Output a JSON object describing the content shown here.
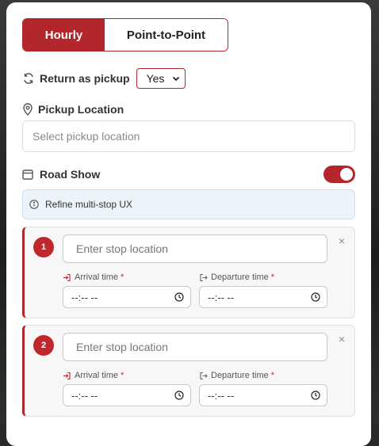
{
  "trip_type": {
    "tabs": [
      {
        "label": "Hourly",
        "active": true
      },
      {
        "label": "Point-to-Point",
        "active": false
      }
    ]
  },
  "return_as_pickup": {
    "label": "Return as pickup",
    "selected": "Yes",
    "icon": "refresh-icon"
  },
  "pickup": {
    "label": "Pickup Location",
    "placeholder": "Select pickup location",
    "icon": "location-pin-icon"
  },
  "road_show": {
    "label": "Road Show",
    "enabled": true,
    "icon": "calendar-icon"
  },
  "info_banner": {
    "text": "Refine multi-stop UX",
    "icon": "info-icon"
  },
  "stops": [
    {
      "number": "1",
      "placeholder": "Enter stop location",
      "arrival_label": "Arrival time",
      "departure_label": "Departure time",
      "required_mark": "*",
      "arrival_value": "--:-- --",
      "departure_value": "--:-- --"
    },
    {
      "number": "2",
      "placeholder": "Enter stop location",
      "arrival_label": "Arrival time",
      "departure_label": "Departure time",
      "required_mark": "*",
      "arrival_value": "--:-- --",
      "departure_value": "--:-- --"
    }
  ],
  "colors": {
    "accent": "#b3262b",
    "info_bg": "#edf3fb"
  }
}
